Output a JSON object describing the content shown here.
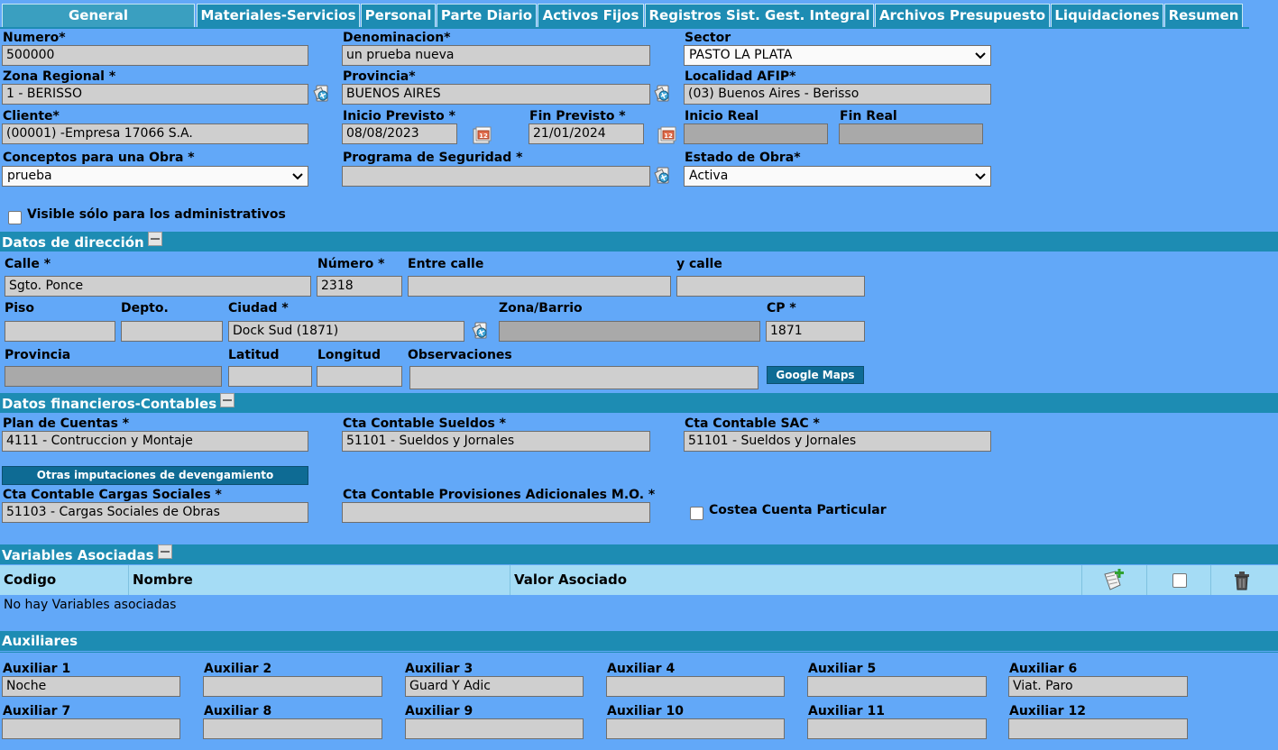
{
  "tabs": [
    {
      "label": "General",
      "active": true
    },
    {
      "label": "Materiales-Servicios"
    },
    {
      "label": "Personal"
    },
    {
      "label": "Parte Diario"
    },
    {
      "label": "Activos Fijos"
    },
    {
      "label": "Registros Sist. Gest. Integral"
    },
    {
      "label": "Archivos Presupuesto"
    },
    {
      "label": "Liquidaciones"
    },
    {
      "label": "Resumen"
    }
  ],
  "general": {
    "numero_label": "Numero*",
    "numero_value": "500000",
    "denominacion_label": "Denominacion*",
    "denominacion_value": "un prueba nueva",
    "sector_label": "Sector",
    "sector_value": "PASTO LA PLATA",
    "zona_label": "Zona Regional *",
    "zona_value": "1 - BERISSO",
    "provincia_label": "Provincia*",
    "provincia_value": "BUENOS AIRES",
    "localidad_label": "Localidad AFIP*",
    "localidad_value": "(03) Buenos Aires - Berisso",
    "cliente_label": "Cliente*",
    "cliente_value": "(00001) -Empresa 17066 S.A.",
    "inicio_prev_label": "Inicio Previsto *",
    "inicio_prev_value": "08/08/2023",
    "fin_prev_label": "Fin Previsto *",
    "fin_prev_value": "21/01/2024",
    "inicio_real_label": "Inicio Real",
    "inicio_real_value": "",
    "fin_real_label": "Fin Real",
    "fin_real_value": "",
    "conceptos_label": "Conceptos para una Obra *",
    "conceptos_value": "prueba",
    "programa_label": "Programa de Seguridad *",
    "programa_value": "",
    "estado_label": "Estado de Obra*",
    "estado_value": "Activa",
    "visible_label": "Visible sólo para los administrativos"
  },
  "direccion": {
    "title": "Datos de dirección",
    "calle_label": "Calle *",
    "calle_value": "Sgto. Ponce",
    "numero_label": "Número *",
    "numero_value": "2318",
    "entre_label": "Entre calle",
    "entre_value": "",
    "ycalle_label": "y calle",
    "ycalle_value": "",
    "piso_label": "Piso",
    "depto_label": "Depto.",
    "ciudad_label": "Ciudad *",
    "ciudad_value": "Dock Sud (1871)",
    "zona_label": "Zona/Barrio",
    "cp_label": "CP *",
    "cp_value": "1871",
    "provincia_label": "Provincia",
    "latitud_label": "Latitud",
    "longitud_label": "Longitud",
    "obs_label": "Observaciones",
    "maps_button": "Google Maps"
  },
  "financiero": {
    "title": "Datos financieros-Contables",
    "plan_label": "Plan de Cuentas *",
    "plan_value": "4111 - Contruccion y Montaje",
    "sueldos_label": "Cta Contable Sueldos *",
    "sueldos_value": "51101 - Sueldos y Jornales",
    "sac_label": "Cta Contable SAC *",
    "sac_value": "51101 - Sueldos y Jornales",
    "otras_button": "Otras imputaciones de devengamiento",
    "cargas_label": "Cta Contable Cargas Sociales *",
    "cargas_value": "51103 - Cargas Sociales de Obras",
    "provisiones_label": "Cta Contable Provisiones Adicionales M.O. *",
    "provisiones_value": "",
    "costea_label": "Costea Cuenta Particular"
  },
  "variables": {
    "title": "Variables Asociadas",
    "columns": [
      "Codigo",
      "Nombre",
      "Valor Asociado"
    ],
    "empty_text": "No hay Variables asociadas"
  },
  "auxiliares": {
    "title": "Auxiliares",
    "items": [
      {
        "label": "Auxiliar 1",
        "value": "Noche"
      },
      {
        "label": "Auxiliar 2",
        "value": ""
      },
      {
        "label": "Auxiliar 3",
        "value": "Guard Y Adic"
      },
      {
        "label": "Auxiliar 4",
        "value": ""
      },
      {
        "label": "Auxiliar 5",
        "value": ""
      },
      {
        "label": "Auxiliar 6",
        "value": "Viat. Paro"
      },
      {
        "label": "Auxiliar 7",
        "value": ""
      },
      {
        "label": "Auxiliar 8",
        "value": ""
      },
      {
        "label": "Auxiliar 9",
        "value": ""
      },
      {
        "label": "Auxiliar 10",
        "value": ""
      },
      {
        "label": "Auxiliar 11",
        "value": ""
      },
      {
        "label": "Auxiliar 12",
        "value": ""
      }
    ]
  },
  "colors": {
    "background": "#62a8f8",
    "header": "#1d8cb3",
    "input": "#cfcfcf",
    "grid_header": "#a5dcf5"
  },
  "icons": {
    "lookup": "search-lookup-icon",
    "calendar": "calendar-icon",
    "add": "add-icon",
    "delete": "trash-icon",
    "collapse": "collapse-icon",
    "dropdown": "chevron-down-icon"
  }
}
